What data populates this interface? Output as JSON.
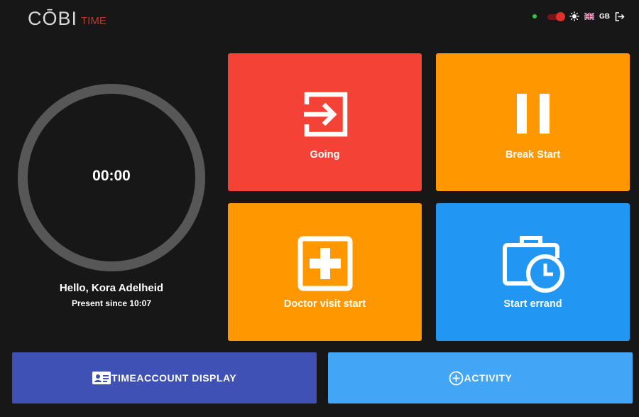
{
  "header": {
    "logo_main": "CŌBI",
    "logo_sub": "TIME",
    "status_online_color": "#2ecc40",
    "toggle_color": "#e0302a",
    "theme_icon": "sun-icon",
    "flag_icon": "uk-flag-icon",
    "language": "GB",
    "logout_icon": "logout-icon"
  },
  "timer": {
    "value": "00:00",
    "greeting": "Hello, Kora Adelheid",
    "present_since": "Present since 10:07"
  },
  "tiles": {
    "going": {
      "label": "Going",
      "icon": "enter-icon",
      "color": "#f44336"
    },
    "break_start": {
      "label": "Break Start",
      "icon": "pause-icon",
      "color": "#ff9800"
    },
    "doctor_visit": {
      "label": "Doctor visit start",
      "icon": "medical-cross-icon",
      "color": "#ff9800"
    },
    "errand": {
      "label": "Start errand",
      "icon": "briefcase-clock-icon",
      "color": "#2196f3"
    }
  },
  "bottom": {
    "timeaccount": {
      "label": "TIMEACCOUNT DISPLAY",
      "icon": "id-card-icon",
      "color": "#3f51b5"
    },
    "activity": {
      "label": "ACTIVITY",
      "icon": "plus-circle-icon",
      "color": "#42a5f5"
    }
  }
}
